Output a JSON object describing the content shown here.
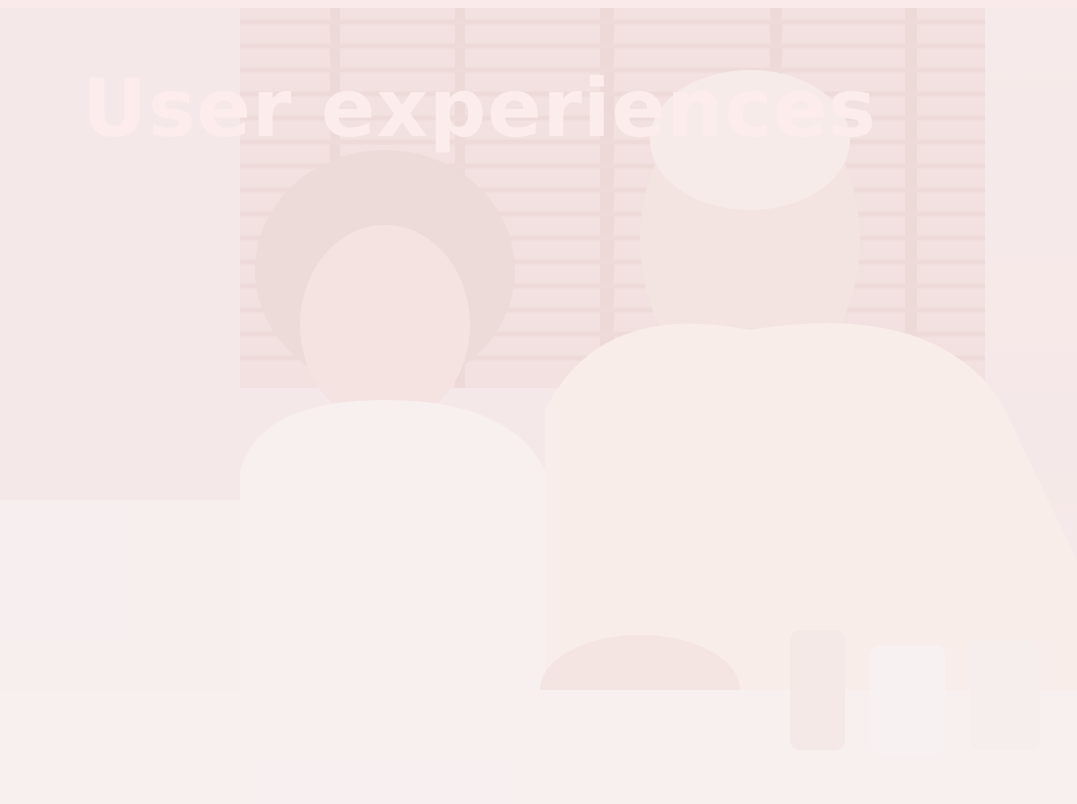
{
  "hero": {
    "title": "User experiences",
    "image": {
      "subject": "older-couple-at-table-photo",
      "overlay_color": "#f7e8e8",
      "title_color": "#fcecec"
    }
  }
}
